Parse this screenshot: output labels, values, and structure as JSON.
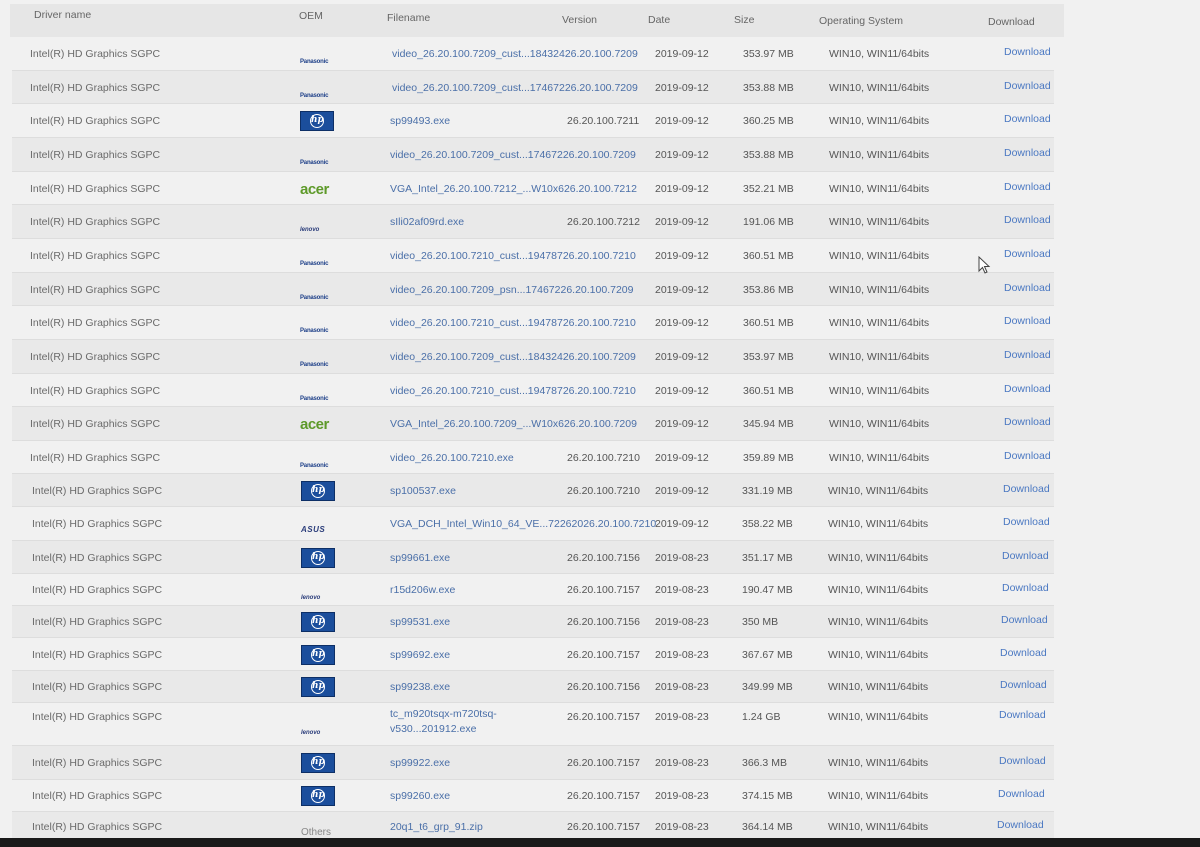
{
  "header": {
    "driver_name": "Driver name",
    "oem": "OEM",
    "filename": "Filename",
    "version": "Version",
    "date": "Date",
    "size": "Size",
    "os": "Operating System",
    "download": "Download"
  },
  "rows": [
    {
      "name": "Intel(R) HD Graphics SGPC",
      "oem": "Panasonic",
      "oem_logo": "panasonic-logo",
      "file": "video_26.20.100.7209_cust...18432426.20.100.7209",
      "ver": "",
      "date": "2019-09-12",
      "size": "353.97 MB",
      "os": "WIN10, WIN11/64bits",
      "dl": "Download"
    },
    {
      "name": "Intel(R) HD Graphics SGPC",
      "oem": "Panasonic",
      "oem_logo": "panasonic-logo",
      "file": "video_26.20.100.7209_cust...17467226.20.100.7209",
      "ver": "",
      "date": "2019-09-12",
      "size": "353.88 MB",
      "os": "WIN10, WIN11/64bits",
      "dl": "Download"
    },
    {
      "name": "Intel(R) HD Graphics SGPC",
      "oem": "hp",
      "oem_logo": "hp-logo",
      "file": "sp99493.exe",
      "ver": "26.20.100.7211",
      "date": "2019-09-12",
      "size": "360.25 MB",
      "os": "WIN10, WIN11/64bits",
      "dl": "Download"
    },
    {
      "name": "Intel(R) HD Graphics SGPC",
      "oem": "Panasonic",
      "oem_logo": "panasonic-logo",
      "file": "video_26.20.100.7209_cust...17467226.20.100.7209",
      "ver": "",
      "date": "2019-09-12",
      "size": "353.88 MB",
      "os": "WIN10, WIN11/64bits",
      "dl": "Download"
    },
    {
      "name": "Intel(R) HD Graphics SGPC",
      "oem": "acer",
      "oem_logo": "acer-logo",
      "file": "VGA_Intel_26.20.100.7212_...W10x626.20.100.7212",
      "ver": "",
      "date": "2019-09-12",
      "size": "352.21 MB",
      "os": "WIN10, WIN11/64bits",
      "dl": "Download"
    },
    {
      "name": "Intel(R) HD Graphics SGPC",
      "oem": "lenovo",
      "oem_logo": "lenovo-logo",
      "file": "sIli02af09rd.exe",
      "ver": "26.20.100.7212",
      "date": "2019-09-12",
      "size": "191.06 MB",
      "os": "WIN10, WIN11/64bits",
      "dl": "Download"
    },
    {
      "name": "Intel(R) HD Graphics SGPC",
      "oem": "Panasonic",
      "oem_logo": "panasonic-logo",
      "file": "video_26.20.100.7210_cust...19478726.20.100.7210",
      "ver": "",
      "date": "2019-09-12",
      "size": "360.51 MB",
      "os": "WIN10, WIN11/64bits",
      "dl": "Download"
    },
    {
      "name": "Intel(R) HD Graphics SGPC",
      "oem": "Panasonic",
      "oem_logo": "panasonic-logo",
      "file": "video_26.20.100.7209_psn...17467226.20.100.7209",
      "ver": "",
      "date": "2019-09-12",
      "size": "353.86 MB",
      "os": "WIN10, WIN11/64bits",
      "dl": "Download"
    },
    {
      "name": "Intel(R) HD Graphics SGPC",
      "oem": "Panasonic",
      "oem_logo": "panasonic-logo",
      "file": "video_26.20.100.7210_cust...19478726.20.100.7210",
      "ver": "",
      "date": "2019-09-12",
      "size": "360.51 MB",
      "os": "WIN10, WIN11/64bits",
      "dl": "Download"
    },
    {
      "name": "Intel(R) HD Graphics SGPC",
      "oem": "Panasonic",
      "oem_logo": "panasonic-logo",
      "file": "video_26.20.100.7209_cust...18432426.20.100.7209",
      "ver": "",
      "date": "2019-09-12",
      "size": "353.97 MB",
      "os": "WIN10, WIN11/64bits",
      "dl": "Download"
    },
    {
      "name": "Intel(R) HD Graphics SGPC",
      "oem": "Panasonic",
      "oem_logo": "panasonic-logo",
      "file": "video_26.20.100.7210_cust...19478726.20.100.7210",
      "ver": "",
      "date": "2019-09-12",
      "size": "360.51 MB",
      "os": "WIN10, WIN11/64bits",
      "dl": "Download"
    },
    {
      "name": "Intel(R) HD Graphics SGPC",
      "oem": "acer",
      "oem_logo": "acer-logo",
      "file": "VGA_Intel_26.20.100.7209_...W10x626.20.100.7209",
      "ver": "",
      "date": "2019-09-12",
      "size": "345.94 MB",
      "os": "WIN10, WIN11/64bits",
      "dl": "Download"
    },
    {
      "name": "Intel(R) HD Graphics SGPC",
      "oem": "Panasonic",
      "oem_logo": "panasonic-logo",
      "file": "video_26.20.100.7210.exe",
      "ver": "26.20.100.7210",
      "date": "2019-09-12",
      "size": "359.89 MB",
      "os": "WIN10, WIN11/64bits",
      "dl": "Download"
    },
    {
      "name": "Intel(R) HD Graphics SGPC",
      "oem": "hp",
      "oem_logo": "hp-logo",
      "file": "sp100537.exe",
      "ver": "26.20.100.7210",
      "date": "2019-09-12",
      "size": "331.19 MB",
      "os": "WIN10, WIN11/64bits",
      "dl": "Download"
    },
    {
      "name": "Intel(R) HD Graphics SGPC",
      "oem": "ASUS",
      "oem_logo": "asus-logo",
      "file": "VGA_DCH_Intel_Win10_64_VE...72262026.20.100.7210",
      "ver": "",
      "date": "2019-09-12",
      "size": "358.22 MB",
      "os": "WIN10, WIN11/64bits",
      "dl": "Download"
    },
    {
      "name": "Intel(R) HD Graphics SGPC",
      "oem": "hp",
      "oem_logo": "hp-logo",
      "file": "sp99661.exe",
      "ver": "26.20.100.7156",
      "date": "2019-08-23",
      "size": "351.17 MB",
      "os": "WIN10, WIN11/64bits",
      "dl": "Download"
    },
    {
      "name": "Intel(R) HD Graphics SGPC",
      "oem": "lenovo",
      "oem_logo": "lenovo-logo",
      "file": "r15d206w.exe",
      "ver": "26.20.100.7157",
      "date": "2019-08-23",
      "size": "190.47 MB",
      "os": "WIN10, WIN11/64bits",
      "dl": "Download"
    },
    {
      "name": "Intel(R) HD Graphics SGPC",
      "oem": "hp",
      "oem_logo": "hp-logo",
      "file": "sp99531.exe",
      "ver": "26.20.100.7156",
      "date": "2019-08-23",
      "size": "350 MB",
      "os": "WIN10, WIN11/64bits",
      "dl": "Download"
    },
    {
      "name": "Intel(R) HD Graphics SGPC",
      "oem": "hp",
      "oem_logo": "hp-logo",
      "file": "sp99692.exe",
      "ver": "26.20.100.7157",
      "date": "2019-08-23",
      "size": "367.67 MB",
      "os": "WIN10, WIN11/64bits",
      "dl": "Download"
    },
    {
      "name": "Intel(R) HD Graphics SGPC",
      "oem": "hp",
      "oem_logo": "hp-logo",
      "file": "sp99238.exe",
      "ver": "26.20.100.7156",
      "date": "2019-08-23",
      "size": "349.99 MB",
      "os": "WIN10, WIN11/64bits",
      "dl": "Download"
    },
    {
      "name": "Intel(R) HD Graphics SGPC",
      "oem": "lenovo",
      "oem_logo": "lenovo-logo",
      "file": "tc_m920tsqx-m720tsq-",
      "file2": "v530...201912.exe",
      "ver": "26.20.100.7157",
      "date": "2019-08-23",
      "size": "1.24 GB",
      "os": "WIN10, WIN11/64bits",
      "dl": "Download"
    },
    {
      "name": "Intel(R) HD Graphics SGPC",
      "oem": "hp",
      "oem_logo": "hp-logo",
      "file": "sp99922.exe",
      "ver": "26.20.100.7157",
      "date": "2019-08-23",
      "size": "366.3 MB",
      "os": "WIN10, WIN11/64bits",
      "dl": "Download"
    },
    {
      "name": "Intel(R) HD Graphics SGPC",
      "oem": "hp",
      "oem_logo": "hp-logo",
      "file": "sp99260.exe",
      "ver": "26.20.100.7157",
      "date": "2019-08-23",
      "size": "374.15 MB",
      "os": "WIN10, WIN11/64bits",
      "dl": "Download"
    },
    {
      "name": "Intel(R) HD Graphics SGPC",
      "oem": "Others",
      "oem_logo": "text",
      "file": "20q1_t6_grp_91.zip",
      "ver": "26.20.100.7157",
      "date": "2019-08-23",
      "size": "364.14 MB",
      "os": "WIN10, WIN11/64bits",
      "dl": "Download"
    }
  ],
  "logos": {
    "panasonic": "Panasonic",
    "lenovo": "lenovo",
    "acer": "acer",
    "asus": "ASUS",
    "hp": "hp"
  }
}
